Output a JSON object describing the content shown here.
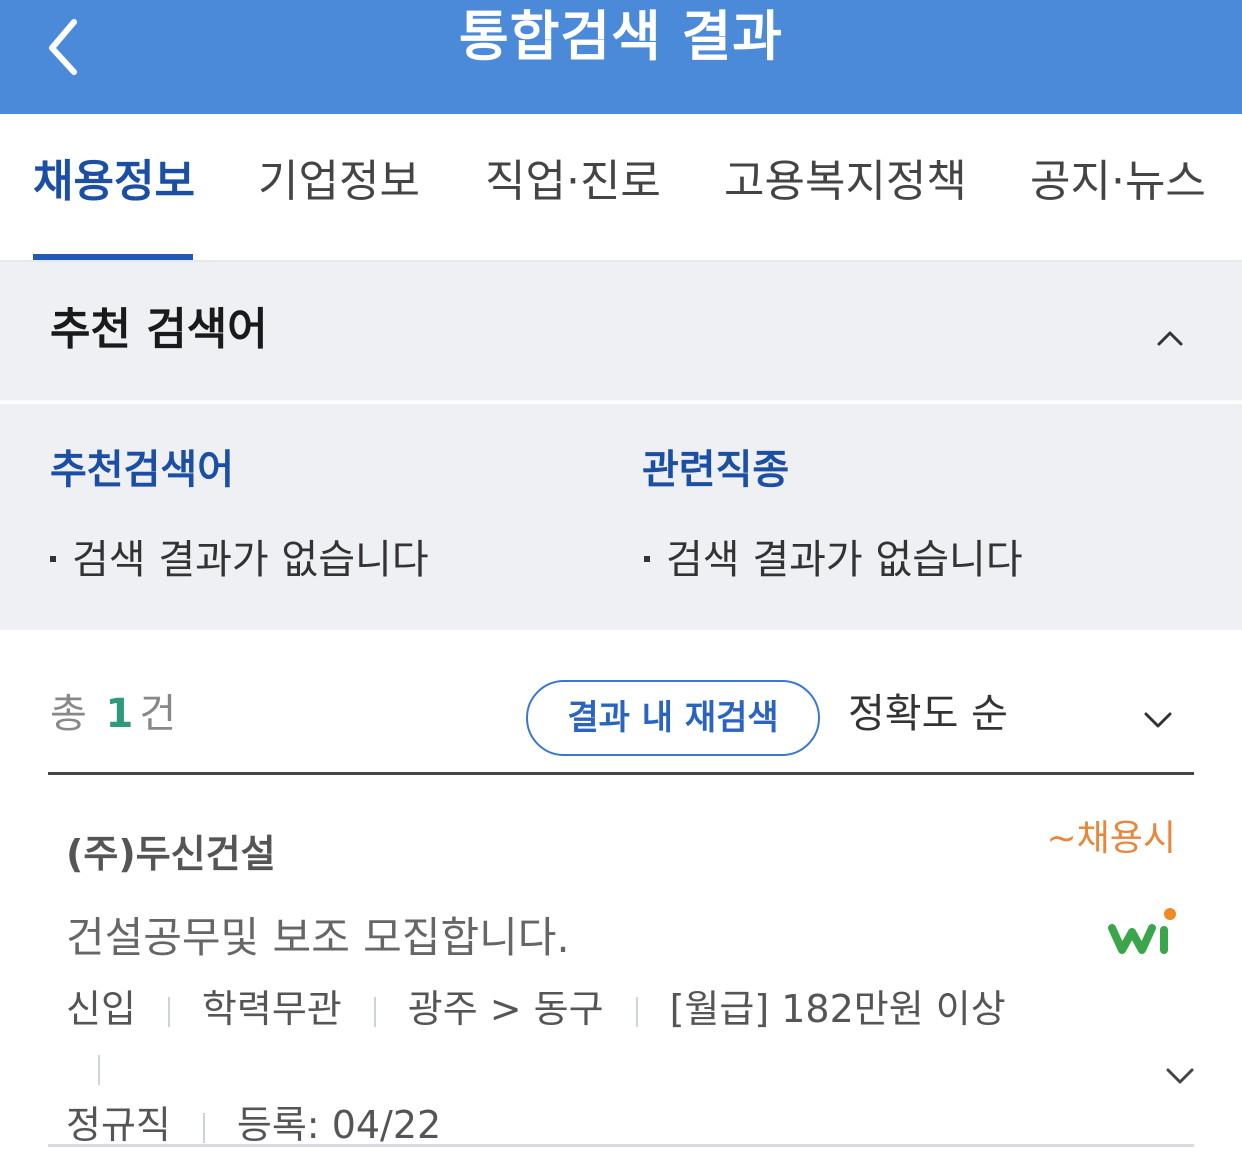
{
  "header": {
    "title": "통합검색 결과",
    "back_icon": "chevron-left-icon"
  },
  "tabs": [
    {
      "label": "채용정보",
      "active": true
    },
    {
      "label": "기업정보",
      "active": false
    },
    {
      "label": "직업·진로",
      "active": false
    },
    {
      "label": "고용복지정책",
      "active": false
    },
    {
      "label": "공지·뉴스",
      "active": false
    }
  ],
  "recommend": {
    "title": "추천 검색어",
    "toggle_icon": "chevron-up-icon",
    "columns": [
      {
        "title": "추천검색어",
        "item": "검색 결과가 없습니다"
      },
      {
        "title": "관련직종",
        "item": "검색 결과가 없습니다"
      }
    ]
  },
  "results": {
    "count_prefix": "총",
    "count": "1",
    "count_suffix": "건",
    "research_label": "결과 내 재검색",
    "sort_label": "정확도 순"
  },
  "job": {
    "company": "(주)두신건설",
    "deadline": "~채용시",
    "title": "건설공무및 보조 모집합니다.",
    "meta": [
      "신입",
      "학력무관",
      "광주 > 동구",
      "[월급] 182만원 이상",
      "정규직",
      "등록: 04/22"
    ]
  },
  "colors": {
    "header_bg": "#4a8ad9",
    "active_tab": "#1b4fa3",
    "section_bg": "#eef0f4",
    "count_accent": "#2e9a7c",
    "deadline": "#e8873a",
    "logo_green": "#3aa54a",
    "logo_orange": "#f08a24"
  }
}
